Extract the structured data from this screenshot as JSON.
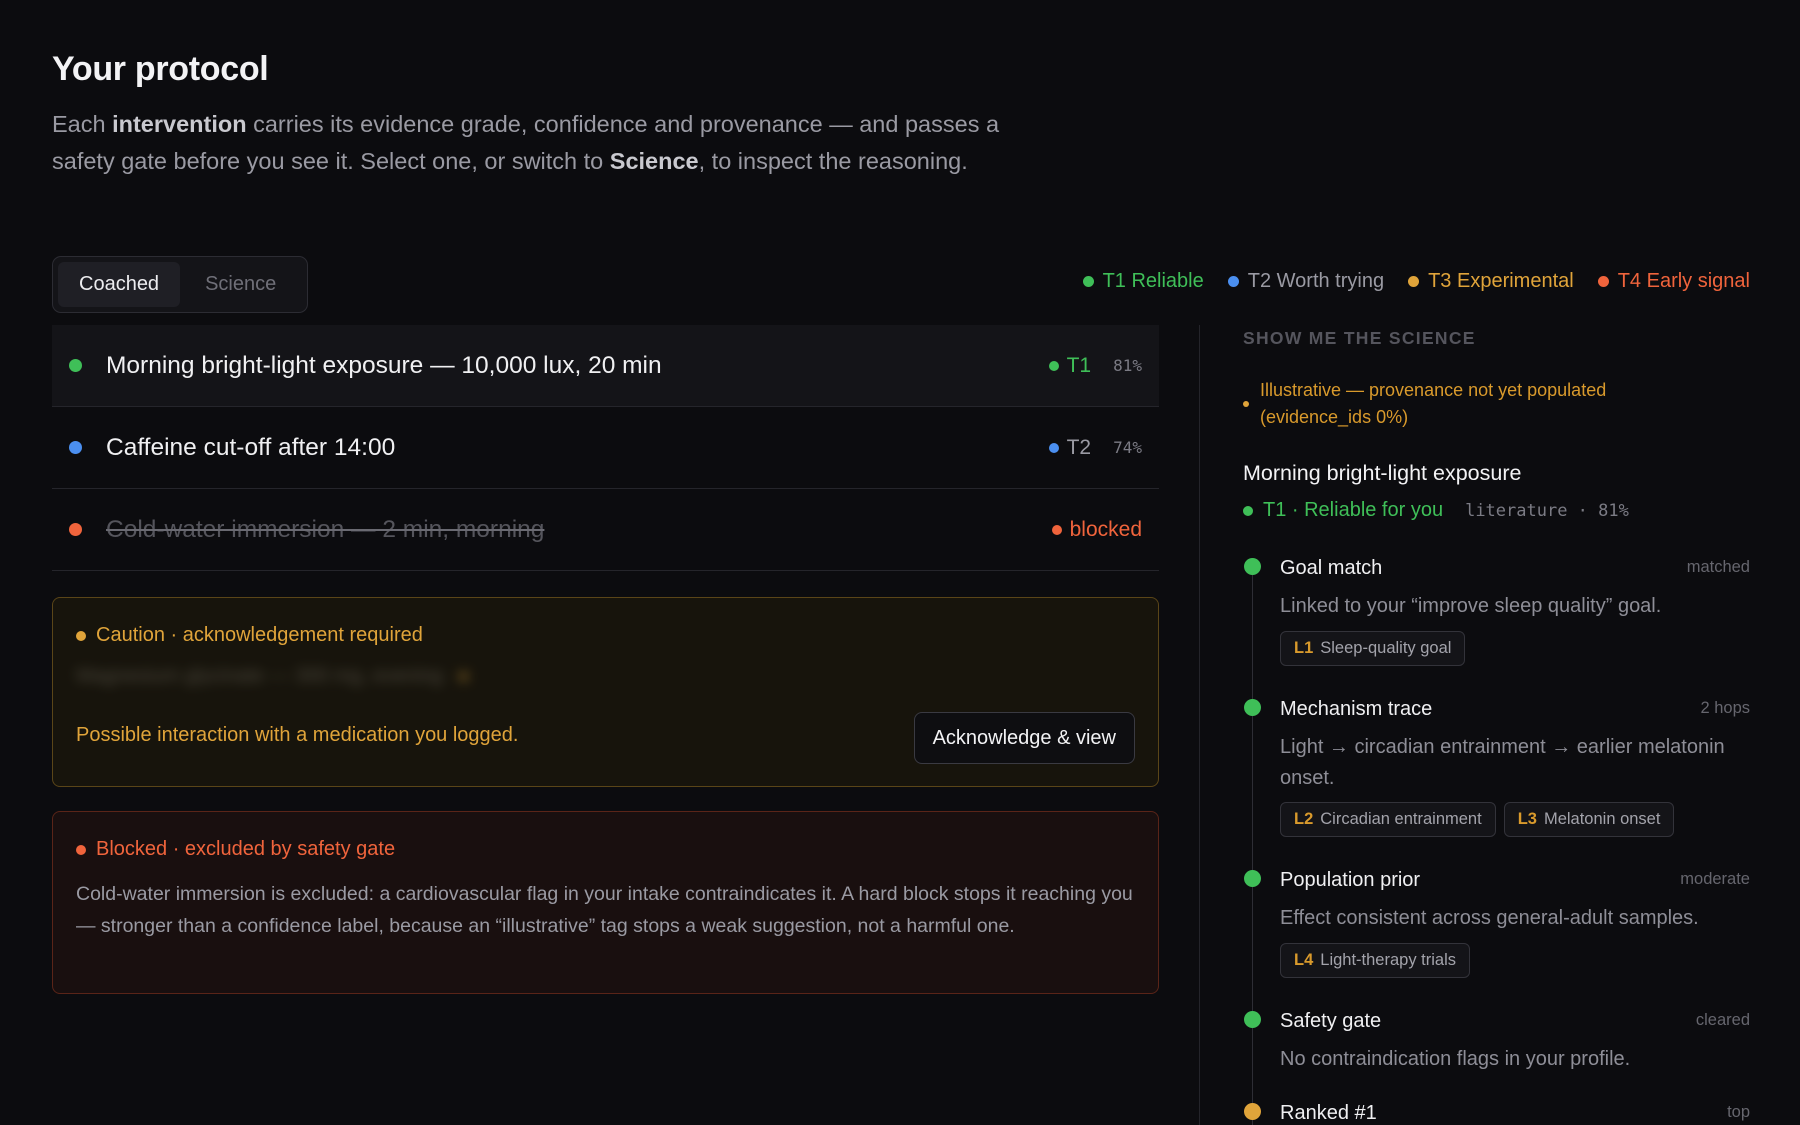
{
  "page": {
    "title": "Your protocol",
    "intro": {
      "t1": "Each ",
      "b1": "intervention",
      "t2": " carries its evidence grade, confidence and provenance — and passes a safety gate before you see it. Select one, or switch to ",
      "b2": "Science",
      "t3": ", to inspect the reasoning."
    }
  },
  "modes": [
    {
      "label": "Coached",
      "active": true
    },
    {
      "label": "Science",
      "active": false
    }
  ],
  "legend": [
    {
      "label": "T1 Reliable",
      "color": "#3fbf58"
    },
    {
      "label": "T2 Worth trying",
      "color": "#4b8ff0"
    },
    {
      "label": "T3 Experimental",
      "color": "#e0a43a"
    },
    {
      "label": "T4 Early signal",
      "color": "#f0643c"
    }
  ],
  "interventions": [
    {
      "label": "Morning bright-light exposure — 10,000 lux, 20 min",
      "tier": "T1",
      "confidence": "81%",
      "dot_color": "#3fbf58"
    },
    {
      "label": "Caffeine cut-off after 14:00",
      "tier": "T2",
      "confidence": "74%",
      "dot_color": "#4b8ff0"
    },
    {
      "label": "Cold-water immersion — 2 min, morning",
      "status": "blocked",
      "dot_color": "#f0643c"
    }
  ],
  "caution": {
    "heading": "Caution · acknowledgement required",
    "blurred_text": "Magnesium glycinate — 300 mg, evening",
    "message": "Possible interaction with a medication you logged.",
    "button": "Acknowledge & view"
  },
  "blocked": {
    "heading": "Blocked · excluded by safety gate",
    "text": "Cold-water immersion is excluded: a cardiovascular flag in your intake contraindicates it. A hard block stops it reaching you — stronger than a confidence label, because an “illustrative” tag stops a weak suggestion, not a harmful one."
  },
  "science": {
    "heading": "SHOW ME THE SCIENCE",
    "illustrative": "Illustrative — provenance not yet populated (evidence_ids 0%)",
    "title": "Morning bright-light exposure",
    "tier_label": "T1 · Reliable for you",
    "source": "literature · 81%",
    "steps": [
      {
        "title": "Goal match",
        "status": "matched",
        "desc": "Linked to your “improve sleep quality” goal.",
        "chips": [
          {
            "level": "L1",
            "label": "Sleep-quality goal"
          }
        ],
        "color": "#3fbf58"
      },
      {
        "title": "Mechanism trace",
        "status": "2 hops",
        "desc": "Light → circadian entrainment → earlier melatonin onset.",
        "chips": [
          {
            "level": "L2",
            "label": "Circadian entrainment"
          },
          {
            "level": "L3",
            "label": "Melatonin onset"
          }
        ],
        "color": "#3fbf58"
      },
      {
        "title": "Population prior",
        "status": "moderate",
        "desc": "Effect consistent across general-adult samples.",
        "chips": [
          {
            "level": "L4",
            "label": "Light-therapy trials"
          }
        ],
        "color": "#3fbf58"
      },
      {
        "title": "Safety gate",
        "status": "cleared",
        "desc": "No contraindication flags in your profile.",
        "chips": [],
        "color": "#3fbf58"
      },
      {
        "title": "Ranked #1",
        "status": "top",
        "desc": "",
        "chips": [],
        "color": "#e0a43a"
      }
    ]
  },
  "colors": {
    "green": "#3fbf58",
    "blue": "#4b8ff0",
    "amber": "#e0a43a",
    "red": "#f0643c"
  }
}
